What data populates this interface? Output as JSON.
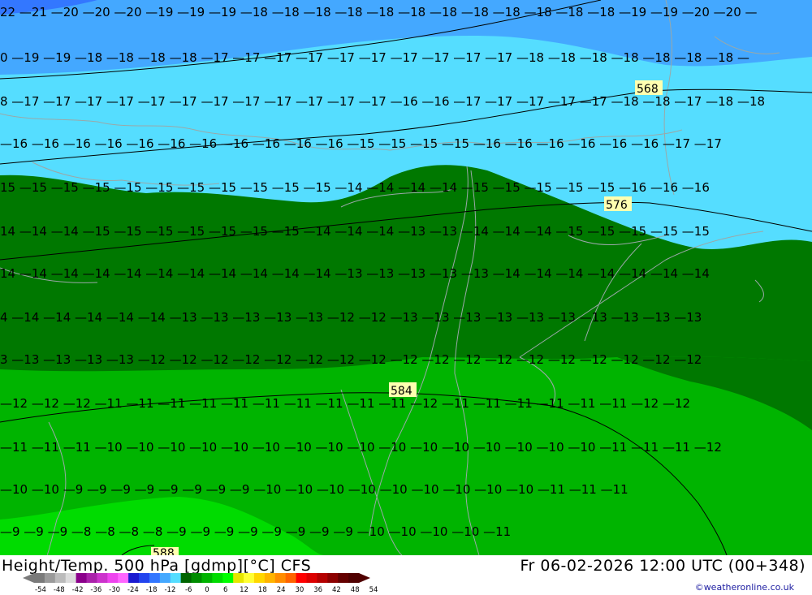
{
  "title_left": "Height/Temp. 500 hPa [gdmp][°C] CFS",
  "title_right": "Fr 06-02-2026 12:00 UTC (00+348)",
  "credit": "©weatheronline.co.uk",
  "colorbar": {
    "ticks": [
      "-54",
      "-48",
      "-42",
      "-36",
      "-30",
      "-24",
      "-18",
      "-12",
      "-6",
      "0",
      "6",
      "12",
      "18",
      "24",
      "30",
      "36",
      "42",
      "48",
      "54"
    ],
    "colors": [
      "#7a7a7a",
      "#9a9a9a",
      "#bbbbbb",
      "#dcdcdc",
      "#8b008b",
      "#aa22aa",
      "#cc33cc",
      "#ee44ee",
      "#ff66ff",
      "#1a1ad0",
      "#2244ee",
      "#3377ff",
      "#44a8ff",
      "#55ddff",
      "#006400",
      "#008c00",
      "#00b400",
      "#00dc00",
      "#00ff00",
      "#e6e600",
      "#ffff33",
      "#ffd700",
      "#ffb400",
      "#ff8c00",
      "#ff6400",
      "#ff0000",
      "#dc0000",
      "#b40000",
      "#8c0000",
      "#640000",
      "#500000"
    ]
  },
  "height_labels": [
    "568",
    "576",
    "584",
    "588"
  ],
  "temperature_labels": [
    {
      "row": 1,
      "values": [
        "22",
        "-21",
        "-20",
        "-20",
        "-20",
        "-19",
        "-19",
        "-19",
        "-18",
        "-18",
        "-18",
        "-18",
        "-18",
        "-18",
        "-18",
        "-18",
        "-18",
        "-18",
        "-18",
        "-18",
        "-19",
        "-19",
        "-20",
        "-20"
      ]
    },
    {
      "row": 2,
      "values": [
        "0",
        "-19",
        "-19",
        "-18",
        "-18",
        "-18",
        "-18",
        "-17",
        "-17",
        "-17",
        "-17",
        "-17",
        "-17",
        "-17",
        "-17",
        "-17",
        "-17",
        "-18",
        "-18",
        "-18",
        "-18",
        "-18",
        "-18",
        "-18"
      ]
    },
    {
      "row": 3,
      "values": [
        "8",
        "-17",
        "-17",
        "-17",
        "-17",
        "-17",
        "-17",
        "-17",
        "-17",
        "-17",
        "-17",
        "-17",
        "-17",
        "-16",
        "-16",
        "-17",
        "-17",
        "-17",
        "-17",
        "-17",
        "-18",
        "-18",
        "-17",
        "-18",
        "-18"
      ]
    },
    {
      "row": 4,
      "values": [
        "-16",
        "-16",
        "-16",
        "-16",
        "-16",
        "-16",
        "-16",
        "-16",
        "-16",
        "-16",
        "-16",
        "-15",
        "-15",
        "-15",
        "-15",
        "-16",
        "-16",
        "-16",
        "-16",
        "-16",
        "-16",
        "-17",
        "-17"
      ]
    },
    {
      "row": 5,
      "values": [
        "15",
        "-15",
        "-15",
        "-15",
        "-15",
        "-15",
        "-15",
        "-15",
        "-15",
        "-15",
        "-15",
        "-14",
        "-14",
        "-14",
        "-14",
        "-15",
        "-15",
        "-15",
        "-15",
        "-15",
        "-16",
        "-16",
        "-16"
      ]
    },
    {
      "row": 6,
      "values": [
        "14",
        "-14",
        "-14",
        "-15",
        "-15",
        "-15",
        "-15",
        "-15",
        "-15",
        "-15",
        "-14",
        "-14",
        "-14",
        "-13",
        "-13",
        "-14",
        "-14",
        "-14",
        "-15",
        "-15",
        "-15",
        "-15",
        "-15"
      ]
    },
    {
      "row": 7,
      "values": [
        "14",
        "-14",
        "-14",
        "-14",
        "-14",
        "-14",
        "-14",
        "-14",
        "-14",
        "-14",
        "-14",
        "-13",
        "-13",
        "-13",
        "-13",
        "-13",
        "-14",
        "-14",
        "-14",
        "-14",
        "-14",
        "-14",
        "-14"
      ]
    },
    {
      "row": 8,
      "values": [
        "4",
        "-14",
        "-14",
        "-14",
        "-14",
        "-14",
        "-13",
        "-13",
        "-13",
        "-13",
        "-13",
        "-12",
        "-12",
        "-13",
        "-13",
        "-13",
        "-13",
        "-13",
        "-13",
        "-13",
        "-13",
        "-13",
        "-13"
      ]
    },
    {
      "row": 9,
      "values": [
        "3",
        "-13",
        "-13",
        "-13",
        "-13",
        "-12",
        "-12",
        "-12",
        "-12",
        "-12",
        "-12",
        "-12",
        "-12",
        "-12",
        "-12",
        "-12",
        "-12",
        "-12",
        "-12",
        "-12",
        "-12",
        "-12",
        "-12"
      ]
    },
    {
      "row": 10,
      "values": [
        "-12",
        "-12",
        "-12",
        "-11",
        "-11",
        "-11",
        "-11",
        "-11",
        "-11",
        "-11",
        "-11",
        "-11",
        "-11",
        "-12",
        "-11",
        "-11",
        "-11",
        "-11",
        "-11",
        "-11",
        "-12",
        "-12"
      ]
    },
    {
      "row": 11,
      "values": [
        "-11",
        "-11",
        "-11",
        "-10",
        "-10",
        "-10",
        "-10",
        "-10",
        "-10",
        "-10",
        "-10",
        "-10",
        "-10",
        "-10",
        "-10",
        "-10",
        "-10",
        "-10",
        "-10",
        "-11",
        "-11",
        "-11",
        "-12"
      ]
    },
    {
      "row": 12,
      "values": [
        "-10",
        "-10",
        "-9",
        "-9",
        "-9",
        "-9",
        "-9",
        "-9",
        "-9",
        "-9",
        "-10",
        "-10",
        "-10",
        "-10",
        "-10",
        "-10",
        "-10",
        "-10",
        "-10",
        "-11",
        "-11",
        "-11"
      ]
    },
    {
      "row": 13,
      "values": [
        "-9",
        "-9",
        "-9",
        "-8",
        "-8",
        "-8",
        "-8",
        "-9",
        "-9",
        "-9",
        "-9",
        "-9",
        "-9",
        "-9",
        "-9",
        "-10",
        "-10",
        "-10",
        "-10",
        "-11"
      ]
    }
  ]
}
